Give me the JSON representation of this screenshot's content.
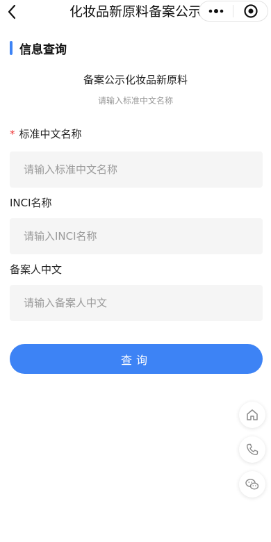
{
  "navbar": {
    "title": "化妆品新原料备案公示",
    "more_icon": "more-dots-icon",
    "close_icon": "target-close-icon"
  },
  "section": {
    "title": "信息查询"
  },
  "info": {
    "title": "备案公示化妆品新原料",
    "subtitle": "请输入标准中文名称"
  },
  "form": {
    "fields": [
      {
        "required": true,
        "required_mark": "*",
        "label": "标准中文名称",
        "placeholder": "请输入标准中文名称",
        "value": ""
      },
      {
        "required": false,
        "label": "INCI名称",
        "placeholder": "请输入INCI名称",
        "value": ""
      },
      {
        "required": false,
        "label": "备案人中文",
        "placeholder": "请输入备案人中文",
        "value": ""
      }
    ],
    "submit_label": "查询"
  },
  "floating": [
    {
      "icon": "home-icon"
    },
    {
      "icon": "phone-icon"
    },
    {
      "icon": "wechat-icon"
    }
  ],
  "colors": {
    "accent": "#3d83f5",
    "required": "#e33333",
    "input_bg": "#f5f5f5"
  }
}
